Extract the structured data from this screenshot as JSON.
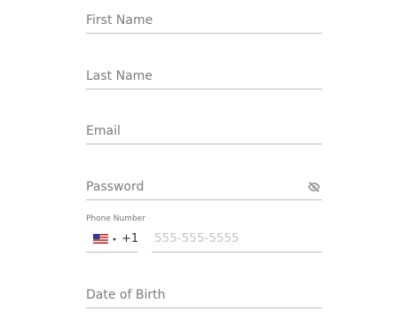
{
  "form": {
    "first_name": {
      "label": "First Name"
    },
    "last_name": {
      "label": "Last Name"
    },
    "email": {
      "label": "Email"
    },
    "password": {
      "label": "Password",
      "toggle_icon": "eye-off-icon"
    },
    "phone": {
      "label": "Phone Number",
      "country_flag": "us-flag-icon",
      "dial_code": "+1",
      "placeholder": "555-555-5555"
    },
    "date_of_birth": {
      "label": "Date of Birth"
    }
  },
  "colors": {
    "label_text": "#7b7b7b",
    "underline": "#bdbdbd",
    "placeholder": "#c4c4c4",
    "dark_text": "#333333"
  }
}
